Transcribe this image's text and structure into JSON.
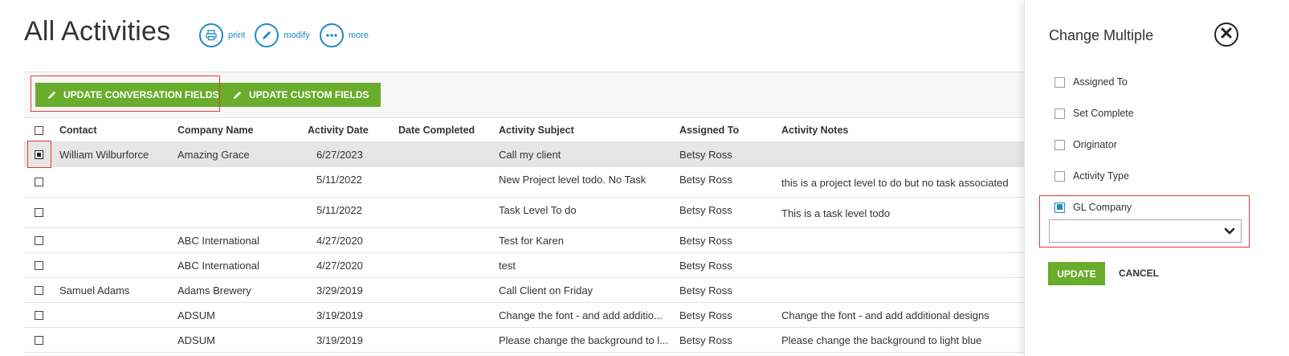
{
  "header": {
    "title": "All Activities",
    "actions": [
      {
        "label": "print",
        "icon": "print-icon"
      },
      {
        "label": "modify",
        "icon": "pencil-icon"
      },
      {
        "label": "more",
        "icon": "more-icon"
      }
    ]
  },
  "toolbar": {
    "update_conversation_label": "UPDATE CONVERSATION FIELDS",
    "update_custom_label": "UPDATE CUSTOM FIELDS"
  },
  "table": {
    "columns": [
      "Contact",
      "Company Name",
      "Activity Date",
      "Date Completed",
      "Activity Subject",
      "Assigned To",
      "Activity Notes"
    ],
    "rows": [
      {
        "checked": true,
        "contact": "William Wilburforce",
        "company": "Amazing Grace",
        "date": "6/27/2023",
        "completed": "",
        "subject": "Call my client",
        "assigned": "Betsy Ross",
        "notes": ""
      },
      {
        "checked": false,
        "contact": "",
        "company": "",
        "date": "5/11/2022",
        "completed": "",
        "subject": "New Project level todo. No Task",
        "assigned": "Betsy Ross",
        "notes": "this is a project level to do but no task associated"
      },
      {
        "checked": false,
        "contact": "",
        "company": "",
        "date": "5/11/2022",
        "completed": "",
        "subject": "Task Level To do",
        "assigned": "Betsy Ross",
        "notes": "This is a task level todo"
      },
      {
        "checked": false,
        "contact": "",
        "company": "ABC International",
        "date": "4/27/2020",
        "completed": "",
        "subject": "Test for Karen",
        "assigned": "Betsy Ross",
        "notes": ""
      },
      {
        "checked": false,
        "contact": "",
        "company": "ABC International",
        "date": "4/27/2020",
        "completed": "",
        "subject": "test",
        "assigned": "Betsy Ross",
        "notes": ""
      },
      {
        "checked": false,
        "contact": "Samuel Adams",
        "company": "Adams Brewery",
        "date": "3/29/2019",
        "completed": "",
        "subject": "Call Client on Friday",
        "assigned": "Betsy Ross",
        "notes": ""
      },
      {
        "checked": false,
        "contact": "",
        "company": "ADSUM",
        "date": "3/19/2019",
        "completed": "",
        "subject": "Change the font - and add additio...",
        "assigned": "Betsy Ross",
        "notes": "Change the font - and add additional designs"
      },
      {
        "checked": false,
        "contact": "",
        "company": "ADSUM",
        "date": "3/19/2019",
        "completed": "",
        "subject": "Please change the background to l...",
        "assigned": "Betsy Ross",
        "notes": "Please change the background to light blue"
      }
    ]
  },
  "panel": {
    "title": "Change Multiple",
    "fields": [
      {
        "label": "Assigned To",
        "checked": false
      },
      {
        "label": "Set Complete",
        "checked": false
      },
      {
        "label": "Originator",
        "checked": false
      },
      {
        "label": "Activity Type",
        "checked": false
      },
      {
        "label": "GL Company",
        "checked": true
      }
    ],
    "select_value": "",
    "update_label": "UPDATE",
    "cancel_label": "CANCEL"
  },
  "colors": {
    "accent_blue": "#1f8ac9",
    "button_green": "#6aac2b",
    "highlight_red": "#e03b3b"
  }
}
